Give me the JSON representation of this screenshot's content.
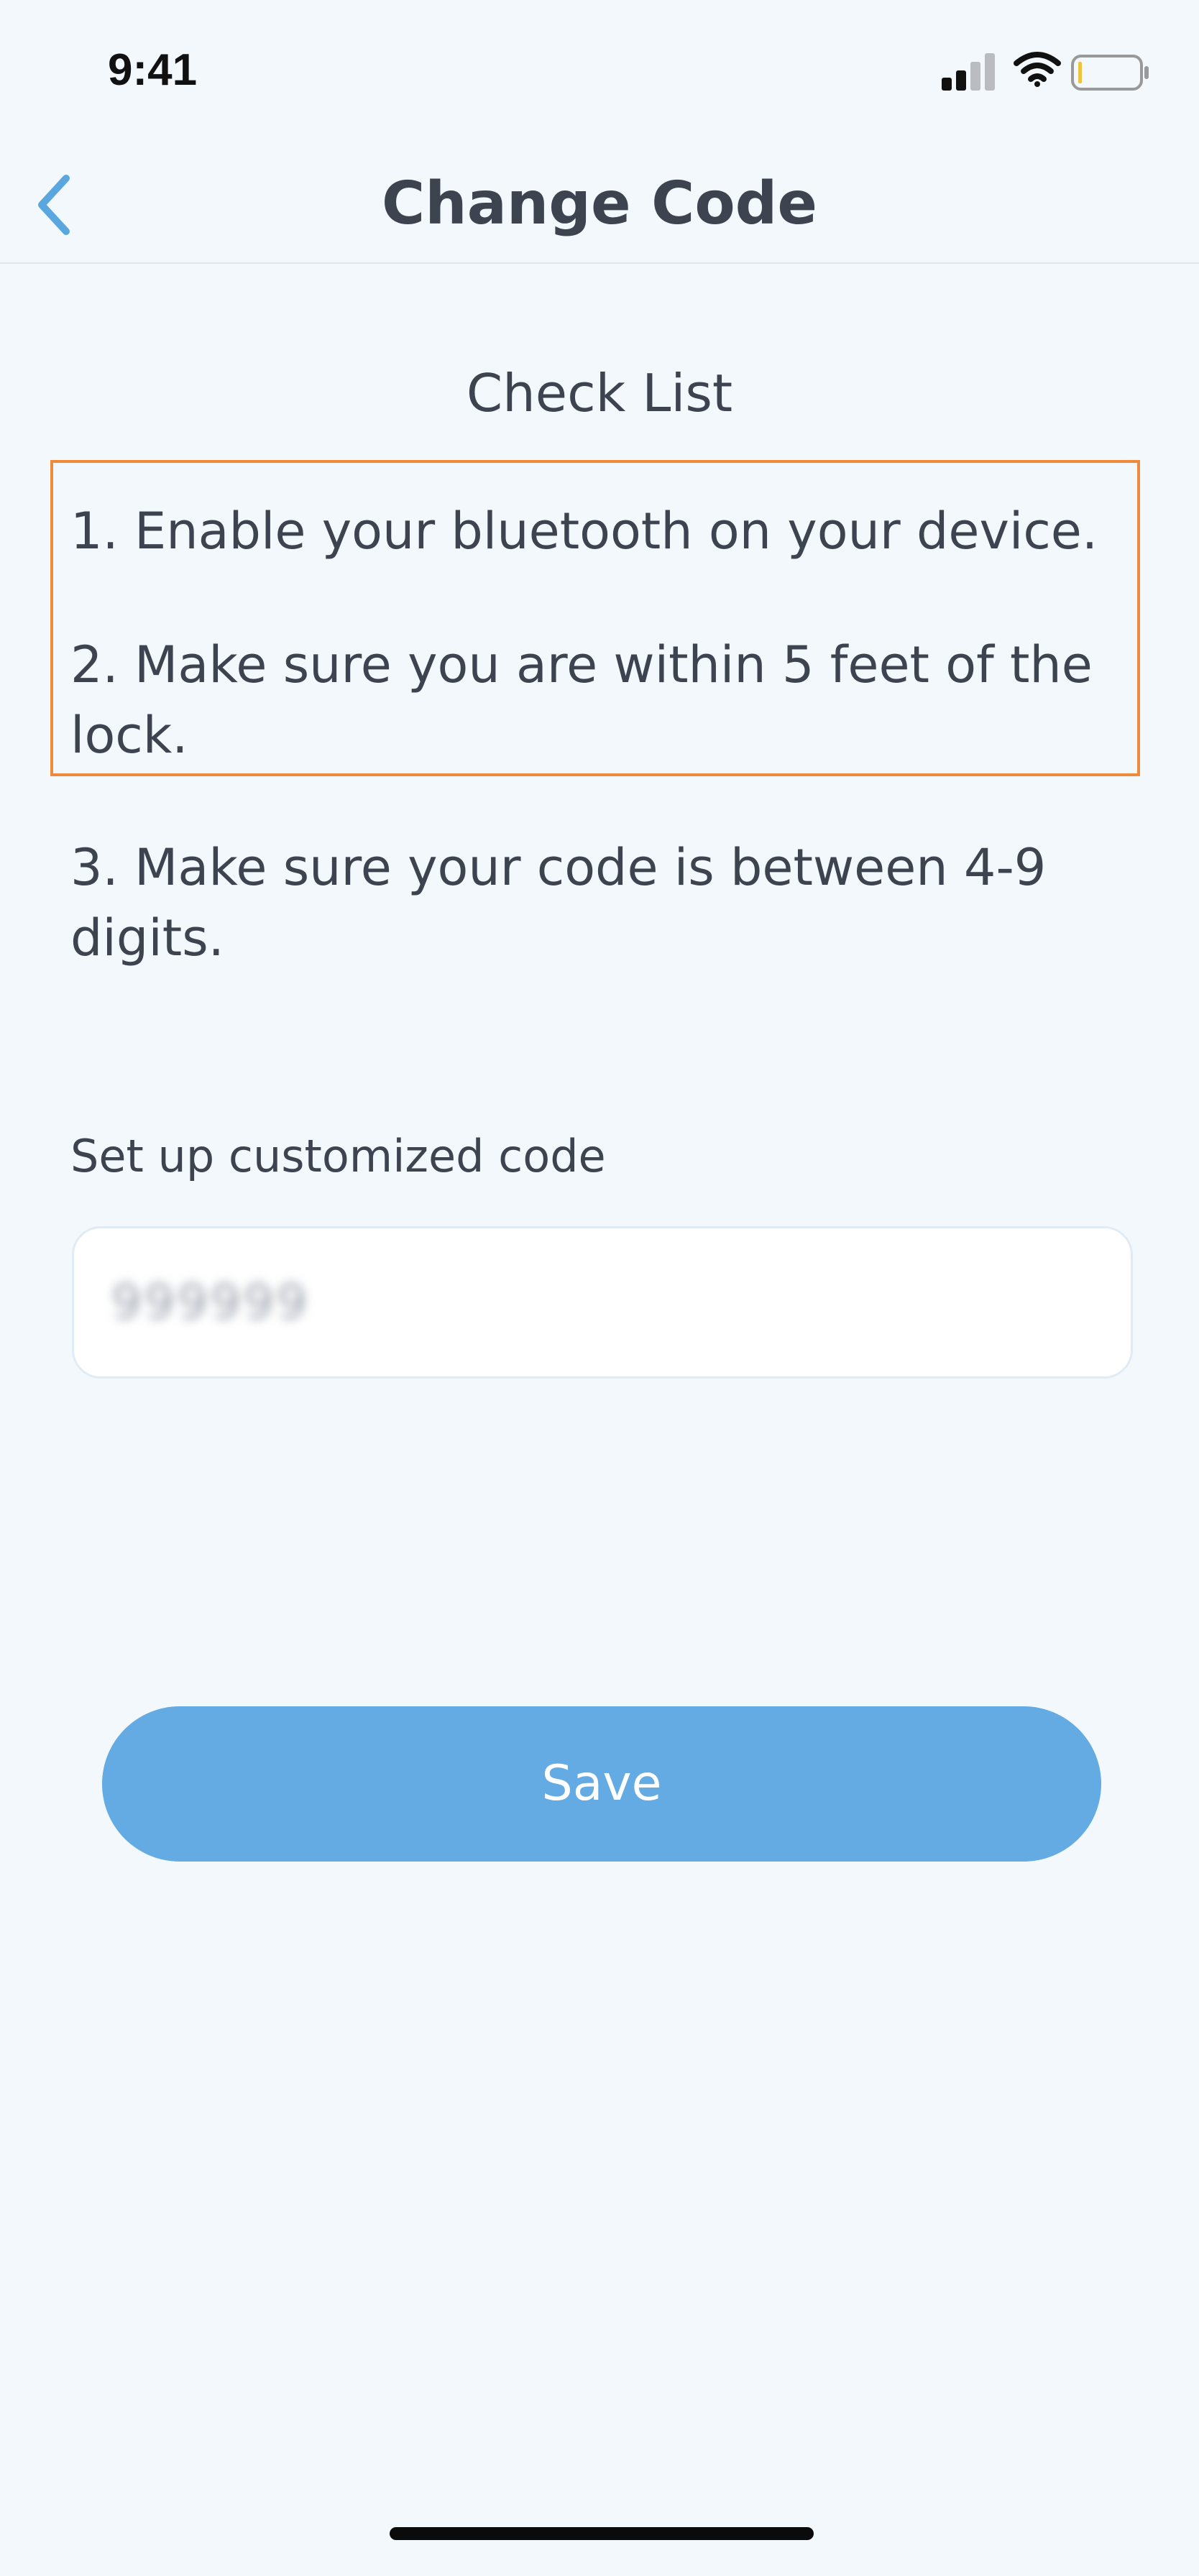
{
  "status_bar": {
    "time": "9:41",
    "icons": [
      "signal-icon",
      "wifi-icon",
      "battery-icon"
    ]
  },
  "nav": {
    "title": "Change Code",
    "back_icon": "chevron-left-icon"
  },
  "checklist": {
    "heading": "Check List",
    "items": [
      "1. Enable your bluetooth on your device.",
      "2. Make sure you are within 5 feet of the lock.",
      "3. Make sure your code is between 4-9 digits."
    ]
  },
  "code_field": {
    "label": "Set up customized code",
    "value": "999999"
  },
  "save_button": {
    "label": "Save"
  },
  "colors": {
    "background": "#f3f8fd",
    "accent": "#64abe4",
    "highlight": "#f08a3a",
    "text": "#3d4450"
  }
}
